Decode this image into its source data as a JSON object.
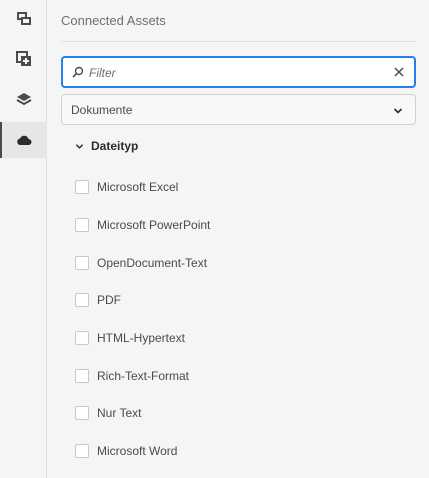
{
  "rail": {
    "items": [
      {
        "name": "assets-icon"
      },
      {
        "name": "add-content-icon"
      },
      {
        "name": "layers-icon"
      },
      {
        "name": "cloud-icon",
        "active": true
      }
    ]
  },
  "panel": {
    "title": "Connected Assets"
  },
  "search": {
    "placeholder": "Filter",
    "value": ""
  },
  "type_select": {
    "value": "Dokumente"
  },
  "filter_group": {
    "label": "Dateityp",
    "options": [
      {
        "label": "Microsoft Excel",
        "checked": false
      },
      {
        "label": "Microsoft PowerPoint",
        "checked": false
      },
      {
        "label": "OpenDocument-Text",
        "checked": false
      },
      {
        "label": "PDF",
        "checked": false
      },
      {
        "label": "HTML-Hypertext",
        "checked": false
      },
      {
        "label": "Rich-Text-Format",
        "checked": false
      },
      {
        "label": "Nur Text",
        "checked": false
      },
      {
        "label": "Microsoft Word",
        "checked": false
      }
    ]
  },
  "colors": {
    "accent": "#2680eb",
    "rail_bg": "#f5f5f5",
    "text": "#4b4b4b"
  }
}
